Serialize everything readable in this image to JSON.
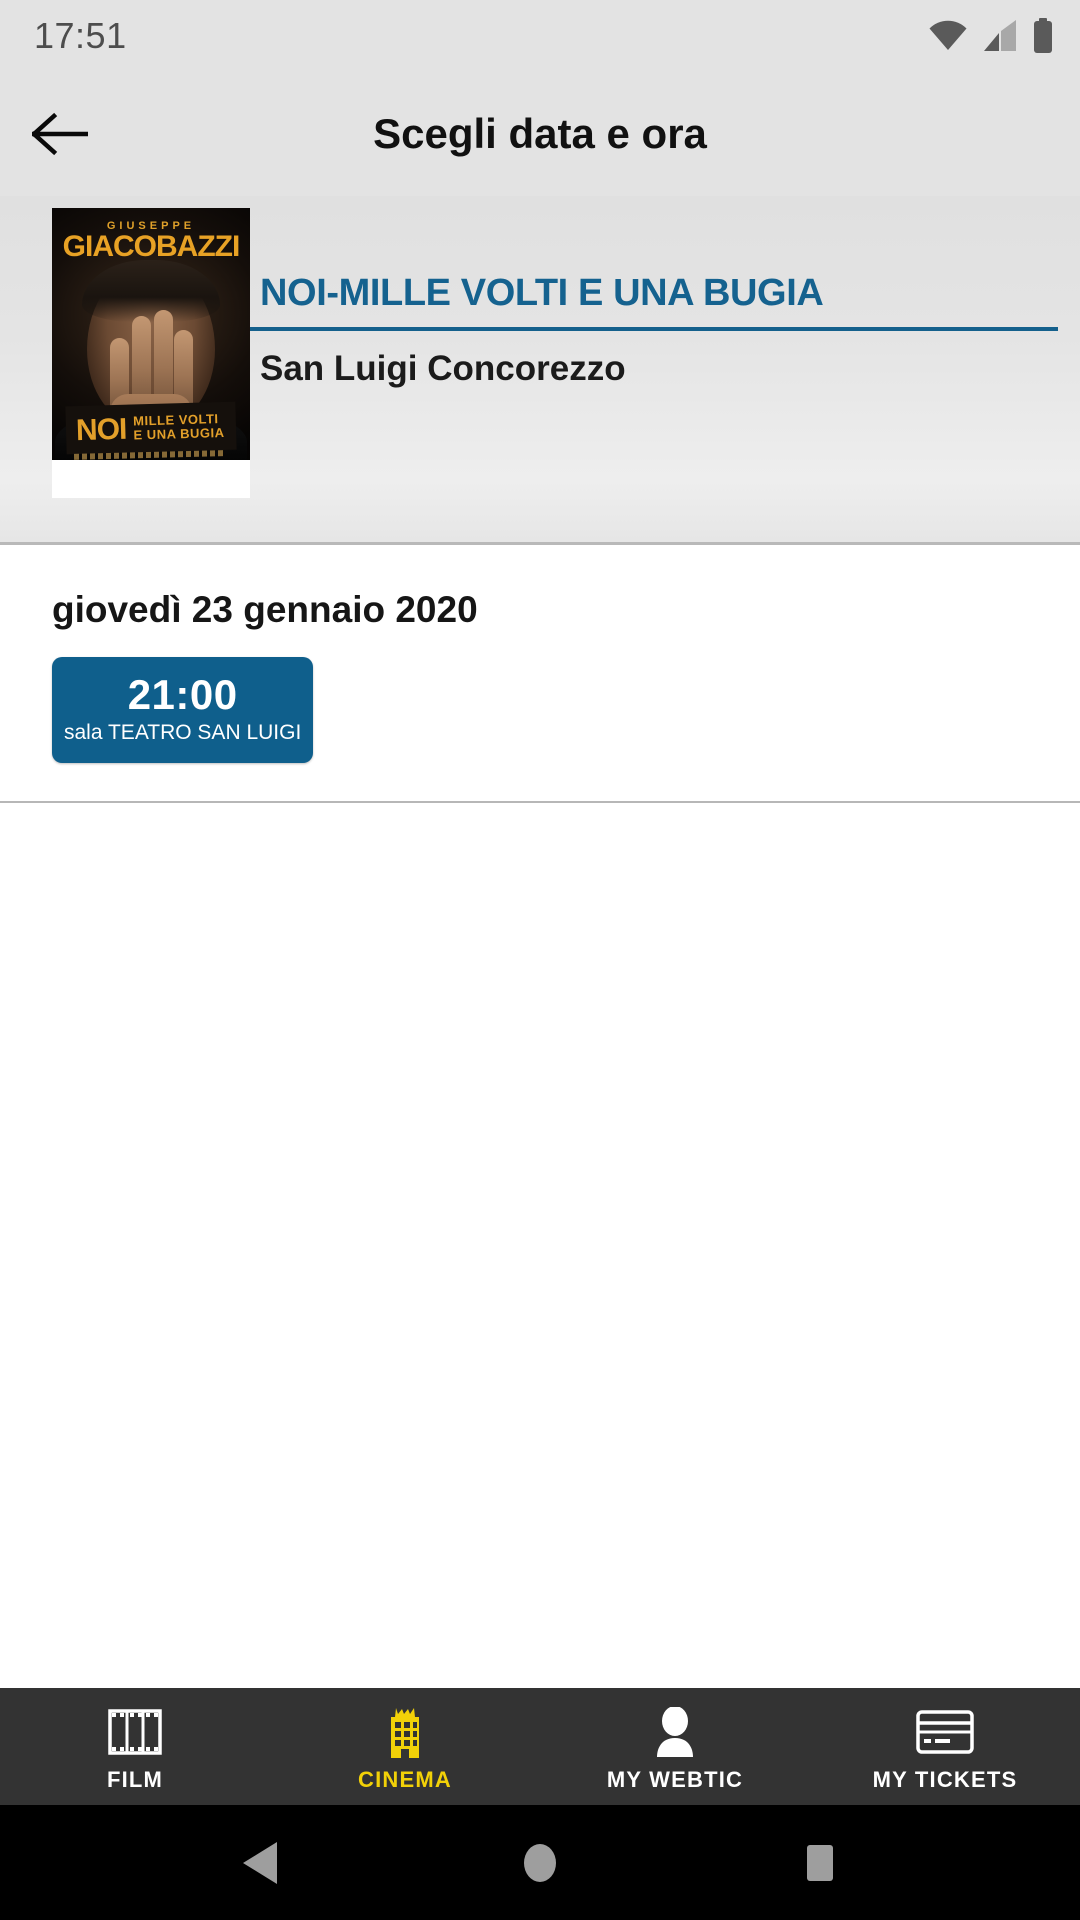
{
  "status_bar": {
    "clock": "17:51",
    "icons": [
      "wifi-icon",
      "cellular-signal-icon",
      "battery-icon"
    ]
  },
  "app_bar": {
    "back_icon": "arrow-left-icon",
    "title": "Scegli data e ora"
  },
  "movie": {
    "poster": {
      "artist_small": "GIUSEPPE",
      "artist_big": "GIACOBAZZI",
      "show_word": "NOI",
      "subtitle_line1": "MILLE VOLTI",
      "subtitle_line2": "E UNA BUGIA"
    },
    "title": "NOI-MILLE VOLTI E UNA BUGIA",
    "venue": "San Luigi Concorezzo"
  },
  "showtimes": [
    {
      "date": "giovedì 23 gennaio 2020",
      "times": [
        {
          "hour": "21:00",
          "hall": "sala TEATRO SAN LUIGI"
        }
      ]
    }
  ],
  "tab_bar": {
    "items": [
      {
        "label": "FILM",
        "icon": "film-strip-icon",
        "active": false
      },
      {
        "label": "CINEMA",
        "icon": "cinema-building-icon",
        "active": true
      },
      {
        "label": "MY WEBTIC",
        "icon": "person-icon",
        "active": false
      },
      {
        "label": "MY TICKETS",
        "icon": "credit-card-icon",
        "active": false
      }
    ]
  },
  "android_nav": {
    "back": "triangle-back-icon",
    "home": "circle-home-icon",
    "recents": "square-recents-icon"
  },
  "colors": {
    "accent_blue": "#0f5f8c",
    "title_blue": "#15628f",
    "tab_active_yellow": "#f2d108",
    "tab_bar_bg": "#333333",
    "header_bg": "#e3e3e3"
  }
}
